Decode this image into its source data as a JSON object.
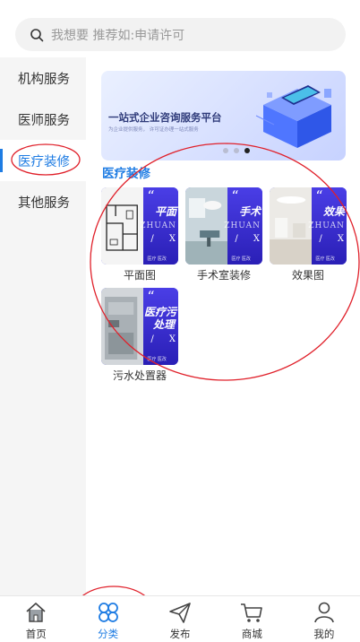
{
  "search": {
    "placeholder": "我想要 推荐如:申请许可"
  },
  "sidebar": {
    "items": [
      {
        "label": "机构服务"
      },
      {
        "label": "医师服务"
      },
      {
        "label": "医疗装修"
      },
      {
        "label": "其他服务"
      }
    ],
    "active_index": 2
  },
  "banner": {
    "title": "一站式企业咨询服务平台",
    "subtitle": "为企业提供服务，  许可证办理一站式服务",
    "active_slide": 3,
    "slide_count": 3
  },
  "section": {
    "title": "医疗装修"
  },
  "tiles": [
    {
      "label": "平面图",
      "thumb_title": "平面",
      "thumb_quote": "“",
      "thumb_pinyin": "ZHUAN",
      "thumb_slash": "/",
      "thumb_x": "X",
      "thumb_bottom": "医疗 医改"
    },
    {
      "label": "手术室装修",
      "thumb_title": "手术",
      "thumb_quote": "“",
      "thumb_pinyin": "ZHUAN",
      "thumb_slash": "/",
      "thumb_x": "X",
      "thumb_bottom": "医疗 医改"
    },
    {
      "label": "效果图",
      "thumb_title": "效果",
      "thumb_quote": "“",
      "thumb_pinyin": "ZHUAN",
      "thumb_slash": "/",
      "thumb_x": "X",
      "thumb_bottom": "医疗 医改"
    },
    {
      "label": "污水处置器",
      "thumb_title": "医疗污",
      "thumb_title2": "处理",
      "thumb_quote": "“",
      "thumb_slash": "/",
      "thumb_x": "X",
      "thumb_bottom": "医疗 医改"
    }
  ],
  "tabbar": {
    "items": [
      {
        "label": "首页",
        "icon": "home-icon"
      },
      {
        "label": "分类",
        "icon": "category-icon"
      },
      {
        "label": "发布",
        "icon": "send-icon"
      },
      {
        "label": "商城",
        "icon": "cart-icon"
      },
      {
        "label": "我的",
        "icon": "user-icon"
      }
    ],
    "active_index": 1
  },
  "colors": {
    "accent": "#1e7ce3",
    "annotation": "#e0202a",
    "thumb_panel": "#3b3fd8"
  }
}
